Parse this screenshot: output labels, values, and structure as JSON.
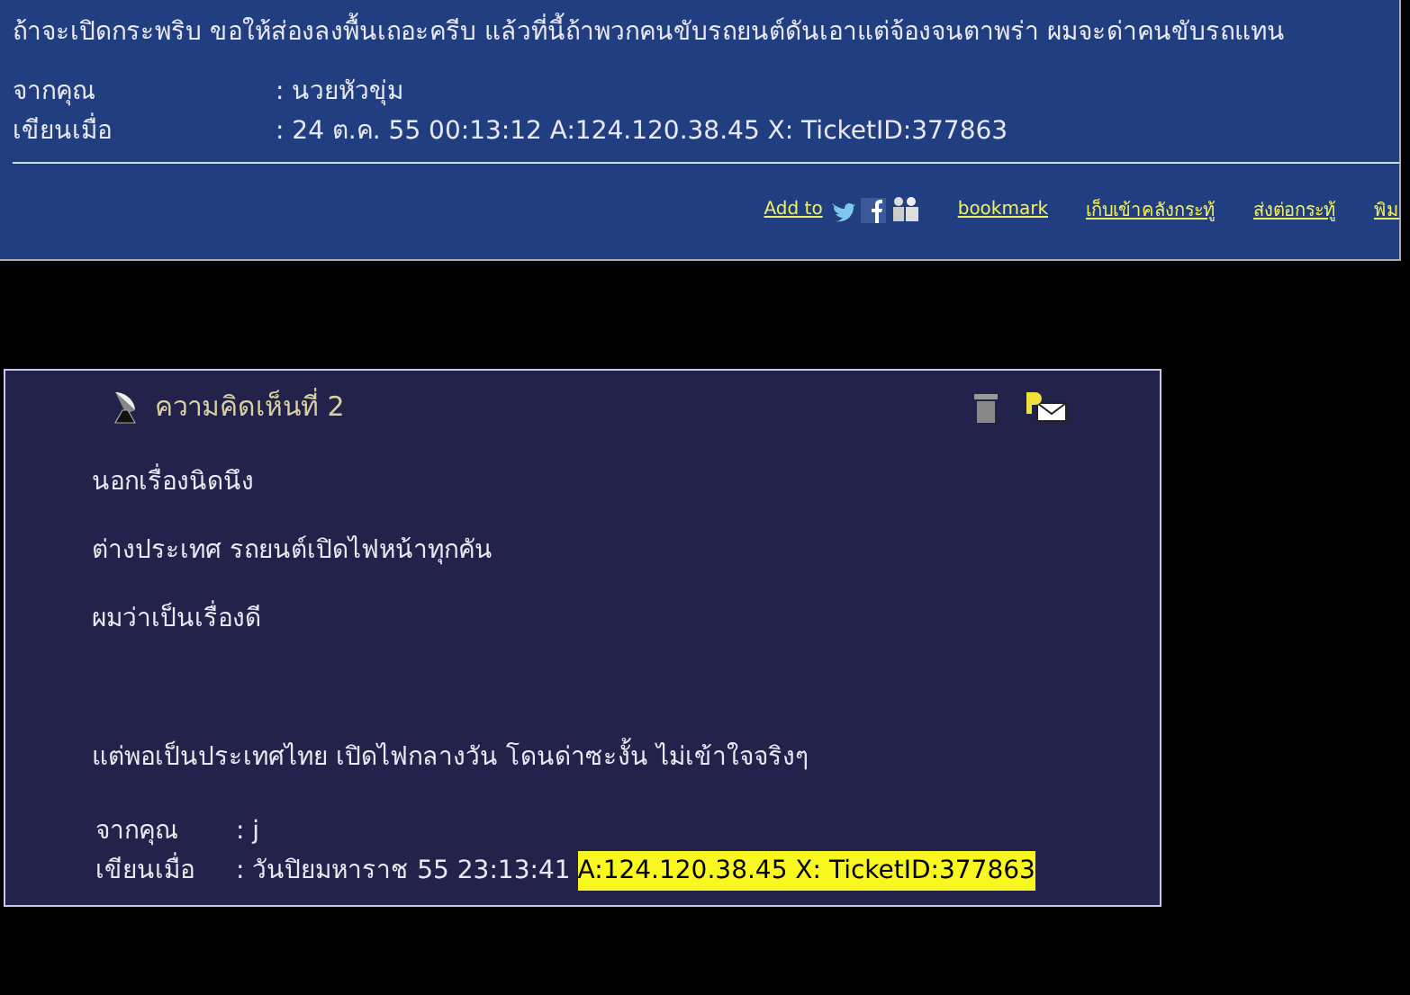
{
  "top_post": {
    "text": "ถ้าจะเปิดกระพริบ ขอให้ส่องลงพื้นเถอะครีบ แล้วที่นี้ถ้าพวกคนขับรถยนต์ดันเอาแต่จ้องจนตาพร่า ผมจะด่าคนขับรถแทน",
    "meta": [
      {
        "label": "จากคุณ",
        "value": ": นวยหัวขุ่ม"
      },
      {
        "label": "เขียนเมื่อ",
        "value": ": 24 ต.ค. 55 00:13:12 A:124.120.38.45 X: TicketID:377863"
      }
    ],
    "add_to": "Add to",
    "links": [
      "bookmark",
      "เก็บเข้าคลังกระทู้",
      "ส่งต่อกระทู้",
      "พิม"
    ]
  },
  "comment": {
    "title": "ความคิดเห็นที่ 2",
    "sections": [
      [
        "นอกเรื่องนิดนึง",
        "ต่างประเทศ รถยนต์เปิดไฟหน้าทุกคัน",
        "ผมว่าเป็นเรื่องดี"
      ],
      [
        "แต่พอเป็นประเทศไทย เปิดไฟกลางวัน โดนด่าซะงั้น ไม่เข้าใจจริงๆ"
      ]
    ],
    "meta": [
      {
        "label": "จากคุณ",
        "value": ": j"
      },
      {
        "label": "เขียนเมื่อ",
        "value": ": วันปิยมหาราช 55 23:13:41",
        "highlight": "A:124.120.38.45 X: TicketID:377863"
      }
    ]
  }
}
